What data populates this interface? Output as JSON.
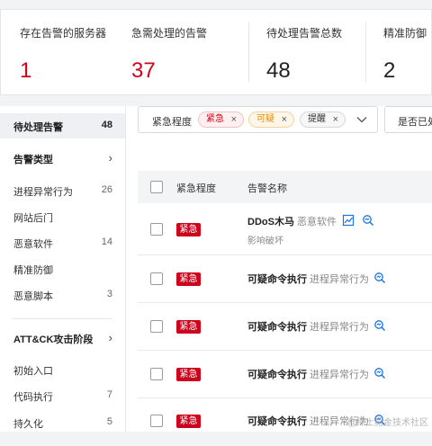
{
  "stats": [
    {
      "label": "存在告警的服务器",
      "value": "1",
      "color": "#d0021b"
    },
    {
      "label": "急需处理的告警",
      "value": "37",
      "color": "#d0021b"
    },
    {
      "label": "待处理告警总数",
      "value": "48",
      "color": "#222222"
    },
    {
      "label": "精准防御",
      "value": "2",
      "color": "#222222"
    }
  ],
  "sidebar": {
    "pending": {
      "label": "待处理告警",
      "count": "48"
    },
    "alert_types": {
      "title": "告警类型",
      "items": [
        {
          "label": "进程异常行为",
          "count": "26"
        },
        {
          "label": "网站后门",
          "count": ""
        },
        {
          "label": "恶意软件",
          "count": "14"
        },
        {
          "label": "精准防御",
          "count": ""
        },
        {
          "label": "恶意脚本",
          "count": "3"
        }
      ]
    },
    "attack_stages": {
      "title": "ATT&CK攻击阶段",
      "items": [
        {
          "label": "初始入口",
          "count": ""
        },
        {
          "label": "代码执行",
          "count": "7"
        },
        {
          "label": "持久化",
          "count": "5"
        }
      ]
    }
  },
  "filters": {
    "urgency_label": "紧急程度",
    "tags": [
      {
        "label": "紧急",
        "close": "×"
      },
      {
        "label": "可疑",
        "close": "×"
      },
      {
        "label": "提醒",
        "close": "×"
      }
    ],
    "handled_label": "是否已处理"
  },
  "table": {
    "headers": {
      "urgency": "紧急程度",
      "name": "告警名称"
    },
    "rows": [
      {
        "badge": "紧急",
        "name": "DDoS木马",
        "category": "恶意软件",
        "sub": "影响破坏"
      },
      {
        "badge": "紧急",
        "name": "可疑命令执行",
        "category": "进程异常行为",
        "sub": ""
      },
      {
        "badge": "紧急",
        "name": "可疑命令执行",
        "category": "进程异常行为",
        "sub": ""
      },
      {
        "badge": "紧急",
        "name": "可疑命令执行",
        "category": "进程异常行为",
        "sub": ""
      },
      {
        "badge": "紧急",
        "name": "可疑命令执行",
        "category": "进程异常行为",
        "sub": ""
      }
    ]
  },
  "watermark": "@稀土掘金技术社区",
  "colors": {
    "danger": "#d0021b",
    "warning": "#e88a00",
    "accent": "#1a73e8"
  },
  "icons": {
    "dropdown": "chevron-down-icon",
    "chevron": "chevron-right-icon",
    "graph": "chart-icon",
    "investigate": "search-analysis-icon"
  }
}
